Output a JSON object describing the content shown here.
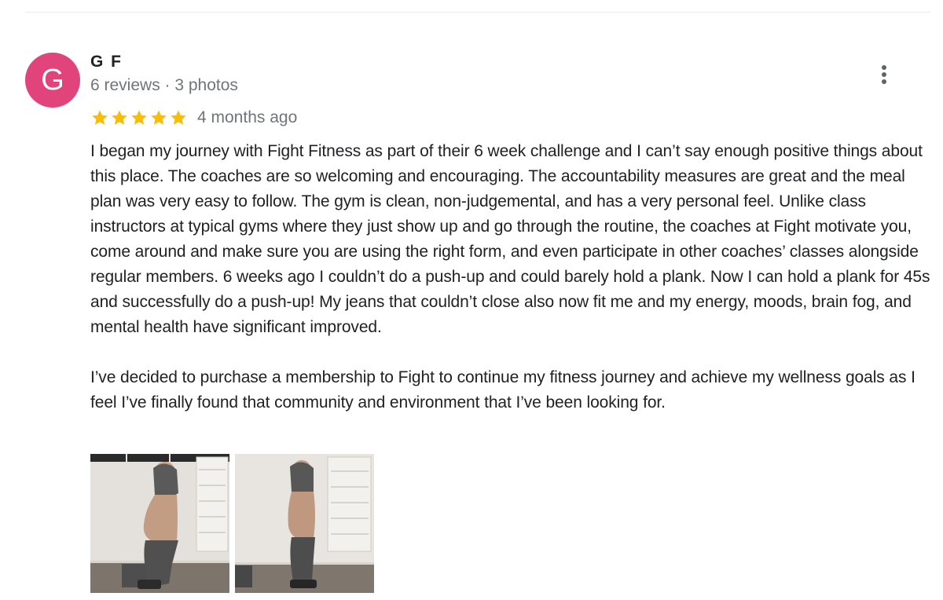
{
  "review": {
    "avatar_letter": "G",
    "author": "G F",
    "meta": "6 reviews · 3 photos",
    "rating": 5,
    "rating_max": 5,
    "time_ago": "4 months ago",
    "paragraphs": [
      "I began my journey with Fight Fitness as part of their 6 week challenge and I can’t say enough positive things about this place. The coaches are so welcoming and encouraging. The accountability measures are great and the meal plan was very easy to follow. The gym is clean, non-judgemental, and has a very personal feel. Unlike class instructors at typical gyms where they just show up and go through the routine, the coaches at Fight motivate you, come around and make sure you are using the right form, and even participate in other coaches’ classes alongside regular members. 6 weeks ago I couldn’t do a push-up and could barely hold a plank. Now I can hold a plank for 45s and successfully do a push-up! My jeans that couldn’t close also now fit me and my energy, moods, brain fog, and mental health have significant improved.",
      "I’ve decided to purchase a membership to Fight to continue my fitness journey and achieve my wellness goals as I feel I’ve finally found that community and environment that I’ve been looking for."
    ],
    "photos": [
      "before-photo",
      "after-photo"
    ]
  },
  "colors": {
    "avatar_bg": "#e0447a",
    "star": "#fbbc04",
    "secondary_text": "#70757a"
  },
  "icons": {
    "more": "more-vert-icon",
    "star": "star-icon"
  }
}
